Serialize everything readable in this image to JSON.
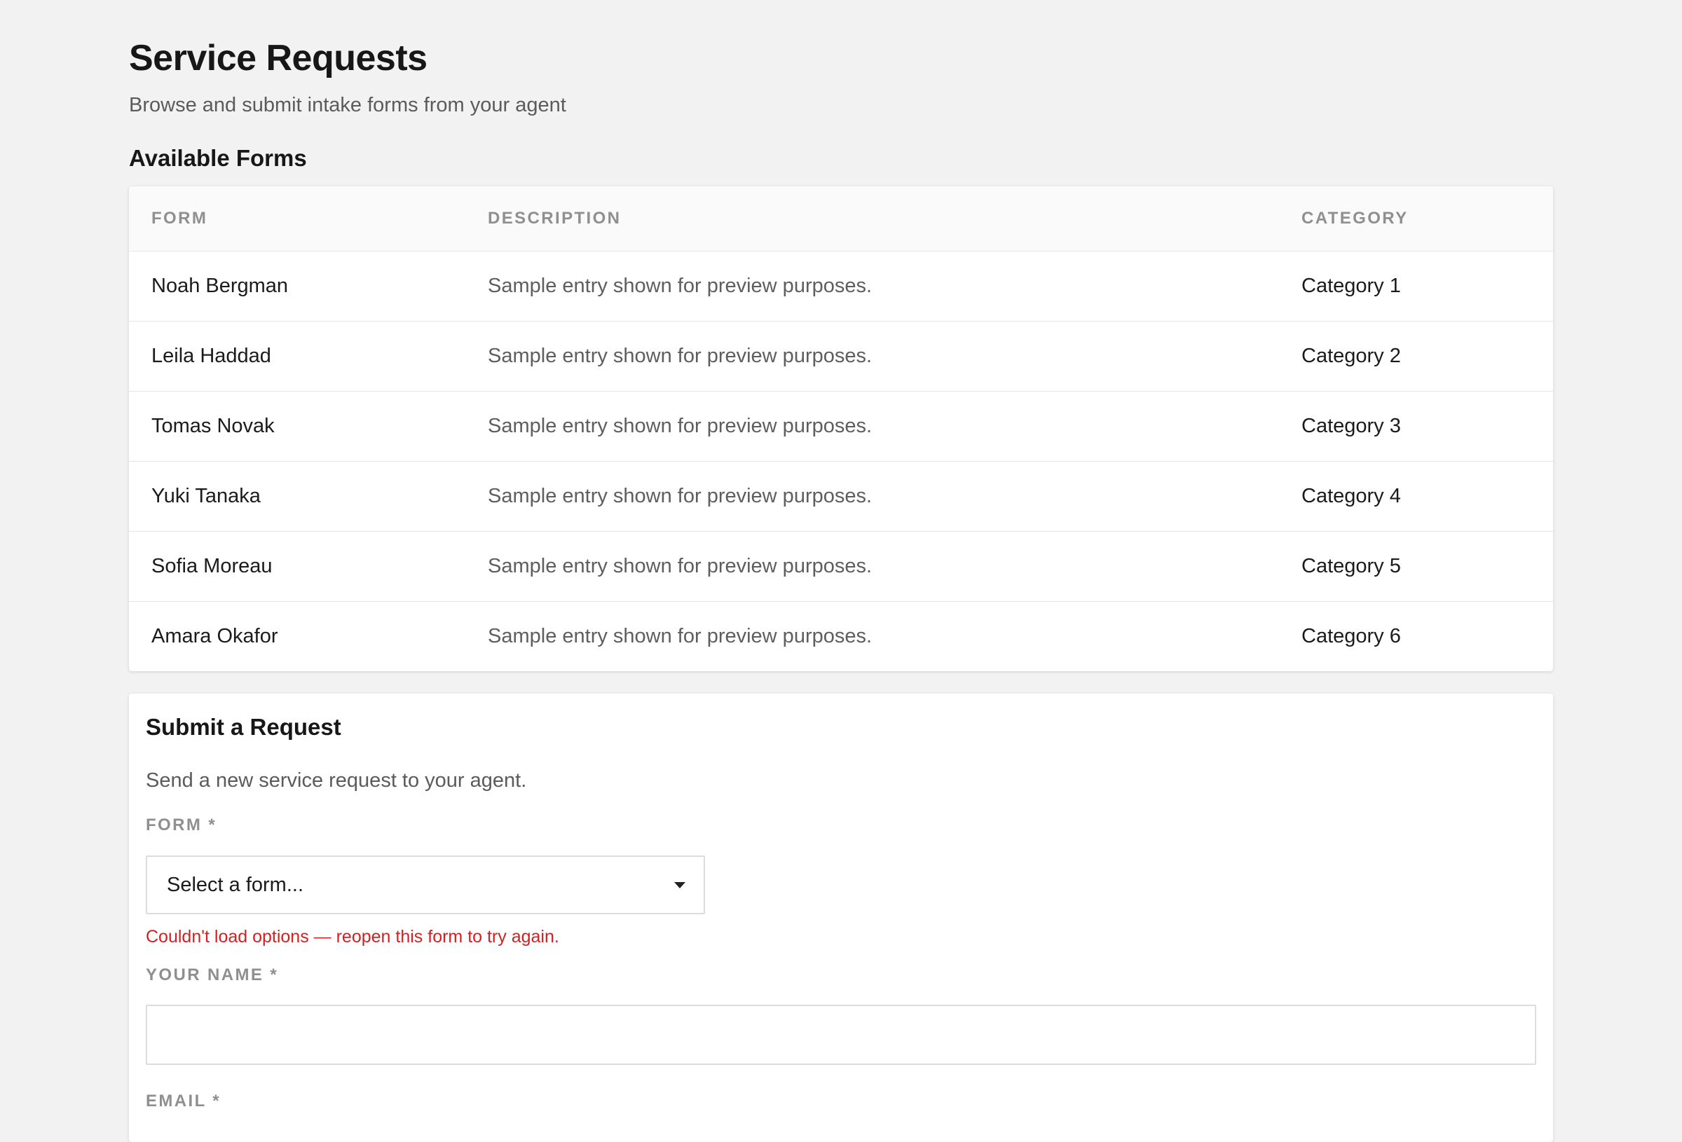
{
  "page": {
    "title": "Service Requests",
    "subtitle": "Browse and submit intake forms from your agent"
  },
  "forms_section": {
    "heading": "Available Forms",
    "columns": {
      "form": "FORM",
      "description": "DESCRIPTION",
      "category": "CATEGORY"
    },
    "rows": [
      {
        "form": "Noah Bergman",
        "description": "Sample entry shown for preview purposes.",
        "category": "Category 1"
      },
      {
        "form": "Leila Haddad",
        "description": "Sample entry shown for preview purposes.",
        "category": "Category 2"
      },
      {
        "form": "Tomas Novak",
        "description": "Sample entry shown for preview purposes.",
        "category": "Category 3"
      },
      {
        "form": "Yuki Tanaka",
        "description": "Sample entry shown for preview purposes.",
        "category": "Category 4"
      },
      {
        "form": "Sofia Moreau",
        "description": "Sample entry shown for preview purposes.",
        "category": "Category 5"
      },
      {
        "form": "Amara Okafor",
        "description": "Sample entry shown for preview purposes.",
        "category": "Category 6"
      }
    ]
  },
  "request_form": {
    "title": "Submit a Request",
    "description": "Send a new service request to your agent.",
    "form_field": {
      "label": "FORM *",
      "selected": "Select a form...",
      "error": "Couldn't load options — reopen this form to try again.",
      "icon": "chevron-down-icon"
    },
    "name_field": {
      "label": "YOUR NAME *",
      "value": ""
    },
    "email_field": {
      "label": "EMAIL *"
    }
  },
  "colors": {
    "background": "#f2f2f2",
    "card": "#ffffff",
    "error": "#d32020",
    "muted_label": "#8f8f8f"
  }
}
